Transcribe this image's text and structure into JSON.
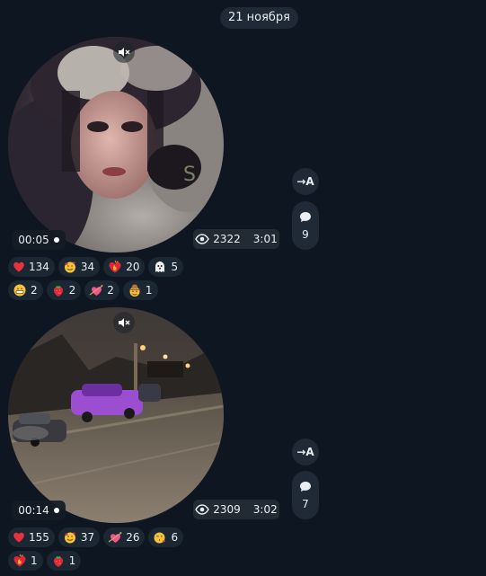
{
  "date_label": "21 ноября",
  "forward_label": "→A",
  "messages": [
    {
      "duration": "00:05",
      "views": "2322",
      "time": "3:01",
      "comments": "9",
      "reactions_row1": [
        {
          "icon": "red-heart",
          "count": "134"
        },
        {
          "icon": "smiling-face-with-hearts",
          "count": "34"
        },
        {
          "icon": "heart-on-fire",
          "count": "20"
        },
        {
          "icon": "ghost",
          "count": "5"
        }
      ],
      "reactions_row2": [
        {
          "icon": "grinning-face",
          "count": "2"
        },
        {
          "icon": "strawberry",
          "count": "2"
        },
        {
          "icon": "heart-with-arrow",
          "count": "2"
        },
        {
          "icon": "cowboy-face",
          "count": "1"
        }
      ]
    },
    {
      "duration": "00:14",
      "views": "2309",
      "time": "3:02",
      "comments": "7",
      "reactions_row1": [
        {
          "icon": "red-heart",
          "count": "155"
        },
        {
          "icon": "smiling-face-with-hearts",
          "count": "37"
        },
        {
          "icon": "heart-with-arrow",
          "count": "26"
        },
        {
          "icon": "face-blowing-kiss",
          "count": "6"
        }
      ],
      "reactions_row2": [
        {
          "icon": "heart-on-fire",
          "count": "1"
        },
        {
          "icon": "strawberry",
          "count": "1"
        }
      ]
    }
  ]
}
